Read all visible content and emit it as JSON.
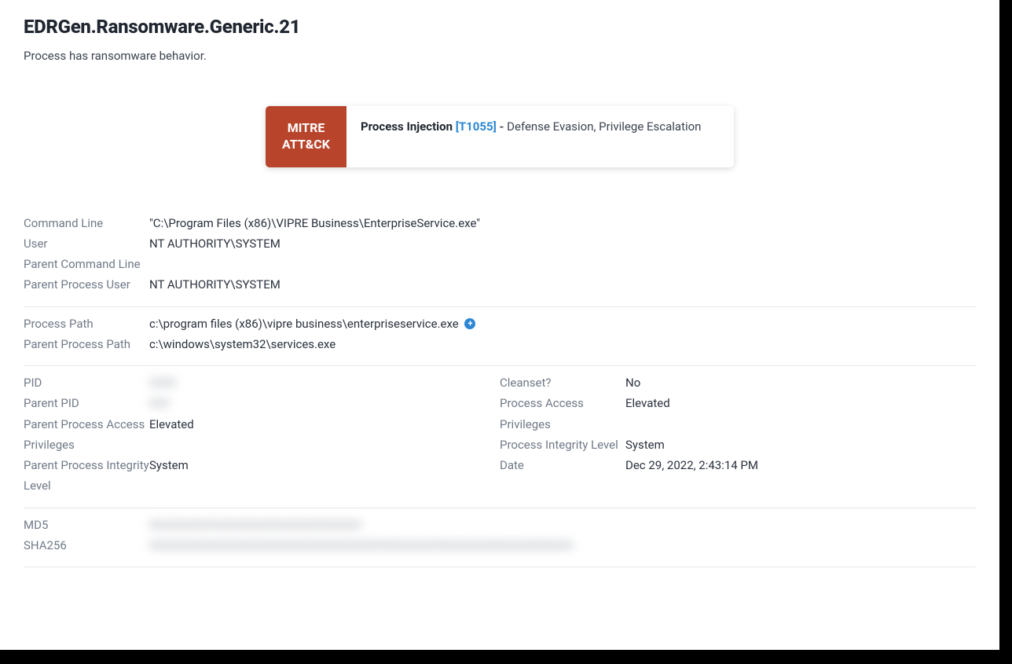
{
  "header": {
    "title": "EDRGen.Ransomware.Generic.21",
    "subtitle": "Process has ransomware behavior."
  },
  "mitre": {
    "badge_line1": "MITRE",
    "badge_line2": "ATT&CK",
    "technique": "Process Injection",
    "technique_id": "[T1055]",
    "dash": " - ",
    "tactics": "Defense Evasion,  Privilege Escalation"
  },
  "sections": {
    "cmd": {
      "command_line_label": "Command Line",
      "command_line_value": "\"C:\\Program Files (x86)\\VIPRE Business\\EnterpriseService.exe\"",
      "user_label": "User",
      "user_value": "NT AUTHORITY\\SYSTEM",
      "parent_cmd_label": "Parent Command Line",
      "parent_cmd_value": "",
      "parent_user_label": "Parent Process User",
      "parent_user_value": "NT AUTHORITY\\SYSTEM"
    },
    "paths": {
      "process_path_label": "Process Path",
      "process_path_value": "c:\\program files (x86)\\vipre business\\enterpriseservice.exe",
      "parent_path_label": "Parent Process Path",
      "parent_path_value": "c:\\windows\\system32\\services.exe"
    },
    "proc": {
      "pid_label": "PID",
      "pid_value": "0000",
      "parent_pid_label": "Parent PID",
      "parent_pid_value": "000",
      "parent_access_label": "Parent Process Access Privileges",
      "parent_access_value": "Elevated",
      "parent_integrity_label": "Parent Process Integrity Level",
      "parent_integrity_value": "System",
      "cleanset_label": "Cleanset?",
      "cleanset_value": "No",
      "access_label": "Process Access Privileges",
      "access_value": "Elevated",
      "integrity_label": "Process Integrity Level",
      "integrity_value": "System",
      "date_label": "Date",
      "date_value": "Dec 29, 2022, 2:43:14 PM"
    },
    "hashes": {
      "md5_label": "MD5",
      "md5_value": "00000000000000000000000000000000",
      "sha256_label": "SHA256",
      "sha256_value": "0000000000000000000000000000000000000000000000000000000000000000"
    }
  }
}
